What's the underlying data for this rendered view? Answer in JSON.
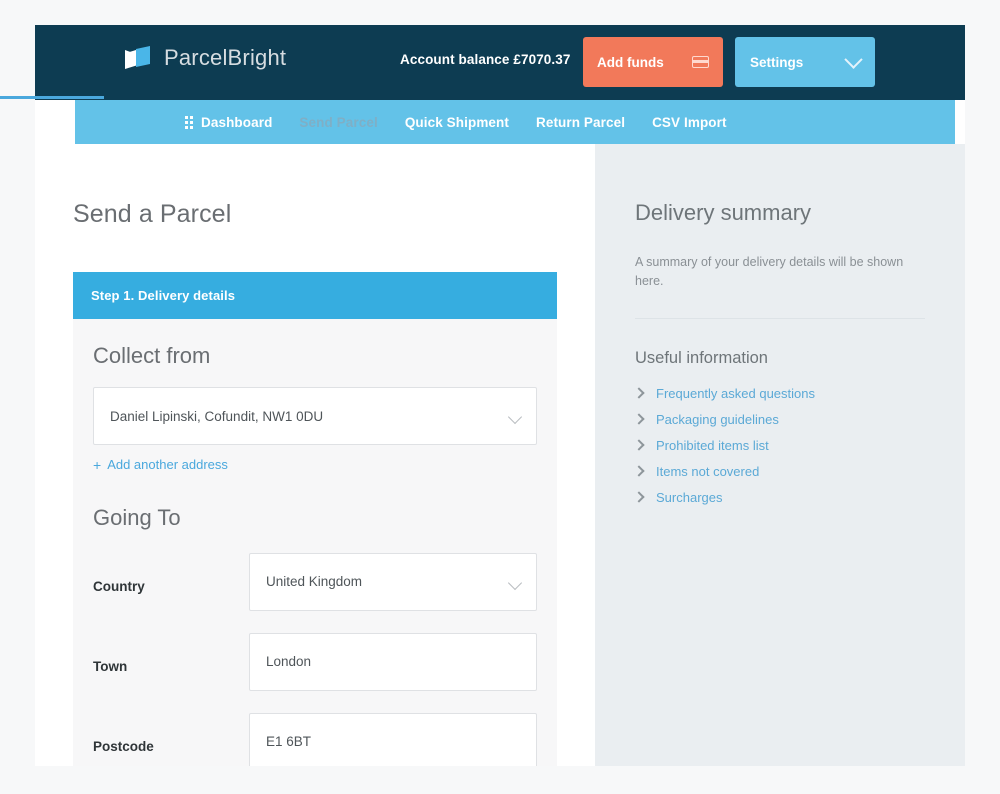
{
  "brand": {
    "name": "ParcelBright",
    "logo_icon": "parcel-book-icon"
  },
  "header": {
    "balance_label": "Account balance £7070.37",
    "add_funds_label": "Add funds",
    "add_funds_icon": "credit-card-icon",
    "settings_label": "Settings",
    "settings_icon": "chevron-down-icon"
  },
  "nav": {
    "items": [
      {
        "label": "Dashboard",
        "icon": "grid-dots-icon",
        "active": false
      },
      {
        "label": "Send Parcel",
        "icon": "",
        "active": true
      },
      {
        "label": "Quick Shipment",
        "icon": "",
        "active": false
      },
      {
        "label": "Return Parcel",
        "icon": "",
        "active": false
      },
      {
        "label": "CSV Import",
        "icon": "",
        "active": false
      }
    ]
  },
  "main": {
    "page_title": "Send a Parcel",
    "step_header": "Step 1. Delivery details",
    "collect_from": {
      "heading": "Collect from",
      "selected_address": "Daniel Lipinski, Cofundit, NW1 0DU",
      "add_another_label": "Add another address",
      "add_another_plus": "+"
    },
    "going_to": {
      "heading": "Going To",
      "fields": [
        {
          "label": "Country",
          "value": "United Kingdom",
          "type": "select"
        },
        {
          "label": "Town",
          "value": "London",
          "type": "text"
        },
        {
          "label": "Postcode",
          "value": "E1 6BT",
          "type": "text"
        }
      ]
    }
  },
  "sidebar": {
    "title": "Delivery summary",
    "description": "A summary of your delivery details will be shown here.",
    "useful_info_title": "Useful information",
    "links": [
      {
        "label": "Frequently asked questions",
        "icon": "chevron-right-icon"
      },
      {
        "label": "Packaging guidelines",
        "icon": "chevron-right-icon"
      },
      {
        "label": "Prohibited items list",
        "icon": "chevron-right-icon"
      },
      {
        "label": "Items not covered",
        "icon": "chevron-right-icon"
      },
      {
        "label": "Surcharges",
        "icon": "chevron-right-icon"
      }
    ]
  },
  "colors": {
    "navy": "#0d3c52",
    "light_blue": "#63c2e8",
    "step_blue": "#36ade0",
    "orange": "#f2795a",
    "link_blue": "#5ba9d6",
    "page_bg": "#f7f8f9",
    "sidebar_bg": "#eaeef1",
    "form_bg": "#f7f7f8"
  }
}
